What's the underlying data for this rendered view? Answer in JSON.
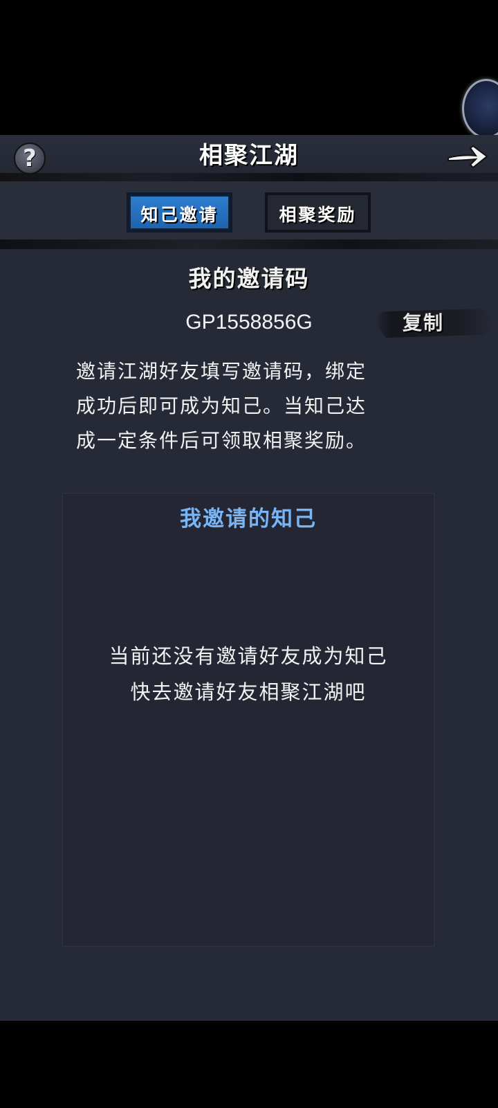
{
  "header": {
    "title": "相聚江湖",
    "help_label": "?",
    "icons": {
      "help": "question-mark-icon",
      "back": "arrow-right-icon"
    }
  },
  "tabs": [
    {
      "label": "知己邀请",
      "active": true
    },
    {
      "label": "相聚奖励",
      "active": false
    }
  ],
  "invite": {
    "title": "我的邀请码",
    "code": "GP1558856G",
    "copy_label": "复制",
    "description_lines": [
      "邀请江湖好友填写邀请码，绑定",
      "成功后即可成为知己。当知己达",
      "成一定条件后可领取相聚奖励。"
    ]
  },
  "friends": {
    "title": "我邀请的知己",
    "empty_lines": [
      "当前还没有邀请好友成为知己",
      "快去邀请好友相聚江湖吧"
    ]
  },
  "colors": {
    "panel_bg": "#262a36",
    "active_tab": "#2a74c4",
    "friends_title": "#79b5f5"
  }
}
